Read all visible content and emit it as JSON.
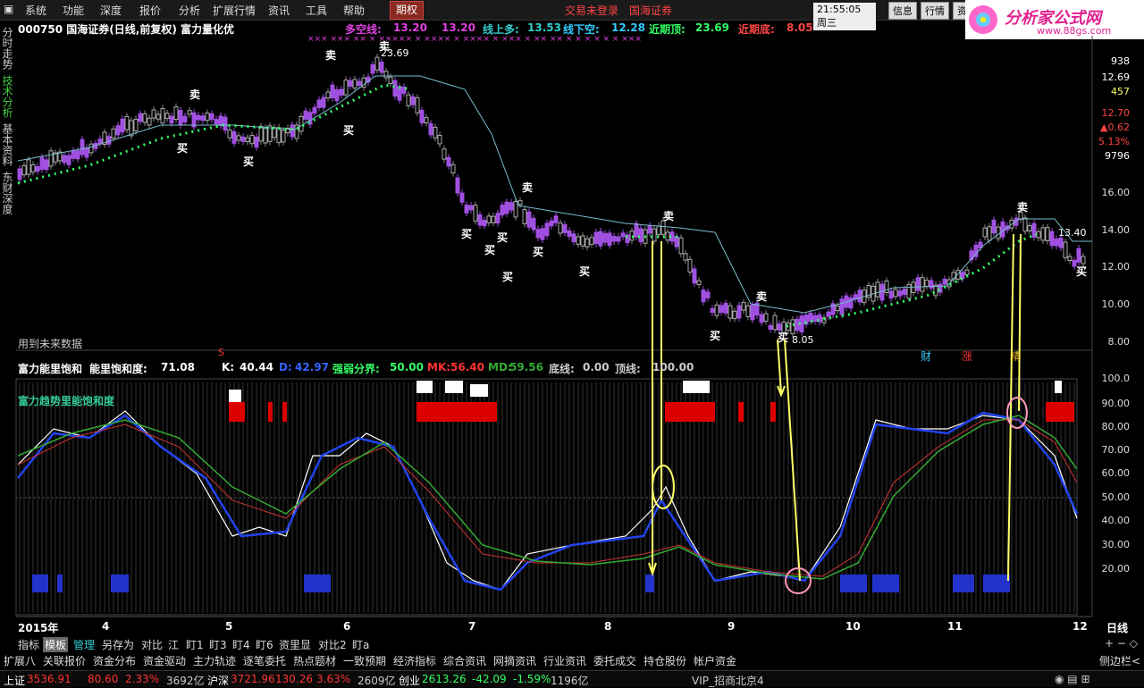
{
  "menu": {
    "items": [
      "系统",
      "功能",
      "深度",
      "报价",
      "分析",
      "扩展行情",
      "资讯",
      "工具",
      "帮助"
    ],
    "active_tab": "期权",
    "login_status": "交易未登录",
    "broker": "国海证券",
    "clock": "21:55:05 周三",
    "right_buttons": [
      "信息",
      "行情",
      "资"
    ]
  },
  "logo": {
    "text": "分析家公式网",
    "url": "www.88gs.com"
  },
  "side_tabs": [
    "分时走势",
    "技术分析",
    "基本资料",
    "东财深度"
  ],
  "stock_header": {
    "code_name": "000750 国海证券(日线,前复权) 富力量化优",
    "duokong_label": "多空线:",
    "duokong_val1": "13.20",
    "duokong_val2": "13.20",
    "xianshangduo_label": "线上多:",
    "xianshangduo_val": "13.53",
    "xianxiakong_label": "线下空:",
    "xianxiakong_val": "12.28",
    "jinqiding_label": "近期顶:",
    "jinqiding_val": "23.69",
    "jinqidi_label": "近期底:",
    "jinqidi_val": "8.05"
  },
  "main_chart": {
    "y_ticks": [
      "16.00",
      "14.00",
      "12.00",
      "10.00",
      "8.00"
    ],
    "right_panel": [
      "938",
      "12.69",
      "457",
      "12.70",
      "▲0.62",
      "5.13%",
      "9796"
    ],
    "peak_label": "23.69",
    "trough_label": "8.05",
    "end_label": "13.40",
    "future_note": "用到未来数据",
    "marker_s": "S",
    "markers": [
      "财",
      "涨",
      "精"
    ],
    "buy_label": "买",
    "sell_label": "卖"
  },
  "indicator_header": {
    "name": "富力能里饱和",
    "value_label": "能里饱和度:",
    "value": "71.08",
    "k_label": "K:",
    "k": "40.44",
    "d_label": "D:",
    "d": "42.97",
    "ruo_label": "强弱分界:",
    "ruo": "50.00",
    "mk_label": "MK:",
    "mk": "56.40",
    "md_label": "MD:",
    "md": "59.56",
    "di_label": "底线:",
    "di": "0.00",
    "ding_label": "顶线:",
    "ding": "100.00"
  },
  "indicator_chart": {
    "title": "富力趋势里能饱和度",
    "y_ticks": [
      "100.0",
      "90.00",
      "80.00",
      "70.00",
      "60.00",
      "50.00",
      "40.00",
      "30.00",
      "20.00"
    ]
  },
  "x_axis": {
    "labels": [
      "2015年",
      "4",
      "5",
      "6",
      "7",
      "8",
      "9",
      "10",
      "11",
      "12"
    ],
    "period": "日线"
  },
  "bottom_tabs": [
    "指标",
    "模板",
    "管理",
    "另存为",
    "对比",
    "江",
    "盯1",
    "盯3",
    "盯4",
    "盯6",
    "资里显",
    "对比2",
    "盯a"
  ],
  "function_bar": [
    "扩展八",
    "关联报价",
    "资金分布",
    "资金驱动",
    "主力轨迹",
    "逐笔委托",
    "热点题材",
    "一致预期",
    "经济指标",
    "综合资讯",
    "网摘资讯",
    "行业资讯",
    "委托成交",
    "持仓股份",
    "帐户资金",
    "侧边栏<"
  ],
  "status_bar": {
    "sh_label": "上证",
    "sh_val": "3536.91",
    "sh_chg": "80.60",
    "sh_pct": "2.33%",
    "sh_amt": "3692亿",
    "hs_label": "沪深",
    "hs_val": "3721.96",
    "hs_chg": "130.26",
    "hs_pct": "3.63%",
    "hs_amt": "2609亿",
    "cy_label": "创业",
    "cy_val": "2613.26",
    "cy_chg": "-42.09",
    "cy_pct": "-1.59%",
    "cy_amt": "1196亿",
    "vip": "VIP_招商北京4"
  },
  "colors": {
    "up": "#ff3333",
    "down": "#33ccff",
    "purple": "#a050e0",
    "green": "#33ff66",
    "yellow": "#ffff66"
  }
}
